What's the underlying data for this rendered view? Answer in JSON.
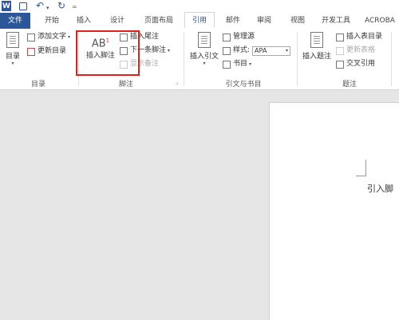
{
  "quick_access": {
    "word_logo": "W",
    "save_icon": "save-icon",
    "undo_icon": "undo-icon",
    "redo_icon": "redo-icon",
    "customize": "="
  },
  "tabs": [
    {
      "label": "文件"
    },
    {
      "label": "开始"
    },
    {
      "label": "插入"
    },
    {
      "label": "设计"
    },
    {
      "label": "页面布局"
    },
    {
      "label": "引用"
    },
    {
      "label": "邮件"
    },
    {
      "label": "审阅"
    },
    {
      "label": "视图"
    },
    {
      "label": "开发工具"
    },
    {
      "label": "ACROBA"
    }
  ],
  "ribbon": {
    "toc": {
      "big_label": "目录",
      "add_text": "添加文字",
      "update_toc": "更新目录",
      "group_label": "目录"
    },
    "footnotes": {
      "insert_footnote": "插入脚注",
      "ab_glyph": "AB",
      "ab_sup": "1",
      "insert_endnote": "插入尾注",
      "next_footnote": "下一条脚注",
      "show_notes": "显示备注",
      "group_label": "脚注"
    },
    "citations": {
      "insert_citation": "插入引文",
      "manage_sources": "管理源",
      "style_label": "样式:",
      "style_value": "APA",
      "bibliography": "书目",
      "group_label": "引文与书目"
    },
    "captions": {
      "insert_caption": "插入题注",
      "insert_table_of_figures": "插入表目录",
      "update_table": "更新表格",
      "cross_reference": "交叉引用",
      "group_label": "题注"
    }
  },
  "document": {
    "visible_text": "引入脚"
  },
  "colors": {
    "accent": "#2b579a",
    "highlight": "#e0201d"
  }
}
